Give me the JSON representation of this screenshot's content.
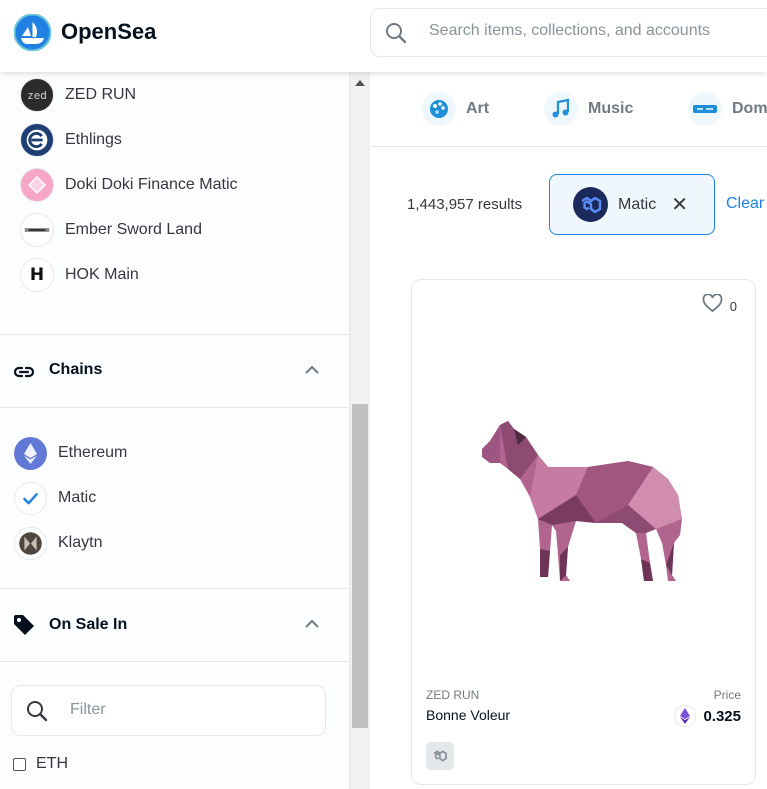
{
  "header": {
    "brand": "OpenSea",
    "search_placeholder": "Search items, collections, and accounts"
  },
  "sidebar": {
    "collections": [
      {
        "label": "ZED RUN",
        "icon": "zed-run-logo"
      },
      {
        "label": "Ethlings",
        "icon": "ethlings-logo"
      },
      {
        "label": "Doki Doki Finance Matic",
        "icon": "doki-doki-logo"
      },
      {
        "label": "Ember Sword Land",
        "icon": "ember-sword-logo"
      },
      {
        "label": "HOK Main",
        "icon": "hok-main-logo"
      }
    ],
    "chains_section": {
      "title": "Chains",
      "icon": "link-icon"
    },
    "chains": [
      {
        "label": "Ethereum",
        "icon": "ethereum-icon",
        "selected": false
      },
      {
        "label": "Matic",
        "icon": "checkmark-icon",
        "selected": true
      },
      {
        "label": "Klaytn",
        "icon": "klaytn-icon",
        "selected": false
      }
    ],
    "on_sale_section": {
      "title": "On Sale In",
      "icon": "tag-icon"
    },
    "filter_placeholder": "Filter",
    "currency_options": [
      {
        "label": "ETH",
        "checked": false
      }
    ]
  },
  "main": {
    "categories": [
      {
        "label": "Art",
        "icon": "art-icon"
      },
      {
        "label": "Music",
        "icon": "music-icon"
      },
      {
        "label": "Domain Names",
        "icon": "domain-icon"
      }
    ],
    "results_text": "1,443,957 results",
    "active_filter": {
      "label": "Matic",
      "icon": "matic-logo"
    },
    "clear_all": "Clear All",
    "card": {
      "favorites": "0",
      "collection": "ZED RUN",
      "name": "Bonne Voleur",
      "price_label": "Price",
      "price": "0.325",
      "currency_icon": "eth-icon",
      "chain_badge_icon": "matic-badge-icon",
      "image": "horse-image"
    }
  },
  "colors": {
    "accent": "#2081e2",
    "text": "#353840",
    "muted": "#707a83",
    "border": "#e5e8eb"
  }
}
